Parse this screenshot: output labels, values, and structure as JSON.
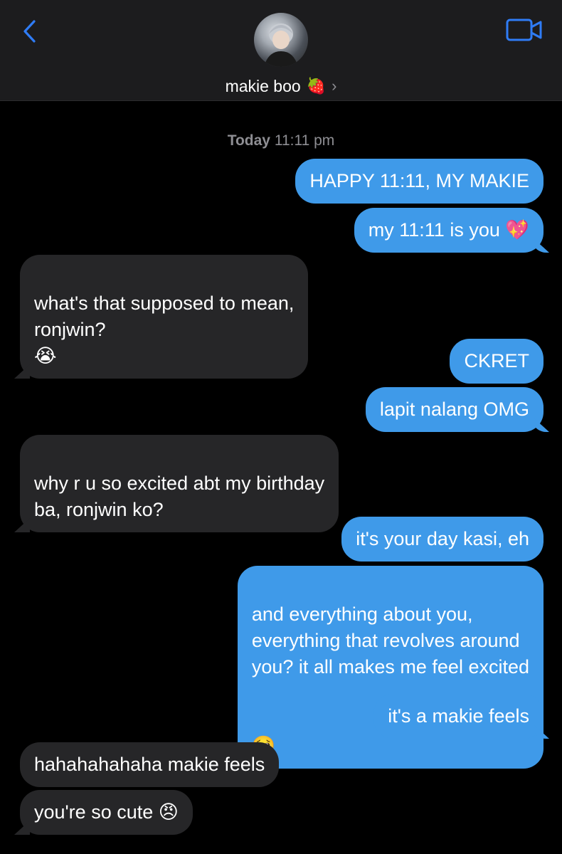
{
  "header": {
    "contact_name": "makie boo",
    "contact_emoji": "🍓",
    "chevron": "›",
    "back_icon": "chevron-left-icon",
    "video_icon": "video-camera-icon",
    "accent": "#2f7cf6"
  },
  "timestamp": {
    "day": "Today",
    "time": "11:11 pm"
  },
  "messages": [
    {
      "side": "sent",
      "text": "HAPPY 11:11, MY MAKIE",
      "emoji": ""
    },
    {
      "side": "sent",
      "text": "my 11:11 is you",
      "emoji": "💖"
    },
    {
      "side": "received",
      "text": "what's that supposed to mean,\nronjwin?",
      "emoji": "😭"
    },
    {
      "side": "sent",
      "text": "CKRET",
      "emoji": ""
    },
    {
      "side": "sent",
      "text": "lapit nalang OMG",
      "emoji": ""
    },
    {
      "side": "received",
      "text": "why r u so excited abt my birthday\nba, ronjwin ko?",
      "emoji": ""
    },
    {
      "side": "sent",
      "text": "it's your day kasi, eh",
      "emoji": ""
    },
    {
      "side": "sent",
      "text": "and everything about you,\neverything that revolves around\nyou? it all makes me feel excited",
      "emoji": "🥺"
    },
    {
      "side": "sent",
      "text": "it's a makie feels",
      "emoji": ""
    },
    {
      "side": "received",
      "text": "hahahahahaha makie feels",
      "emoji": ""
    },
    {
      "side": "received",
      "text": "you're so cute",
      "emoji": "😠"
    }
  ],
  "colors": {
    "sent_bubble": "#3f9ae9",
    "received_bubble": "#262628",
    "background": "#000000"
  }
}
